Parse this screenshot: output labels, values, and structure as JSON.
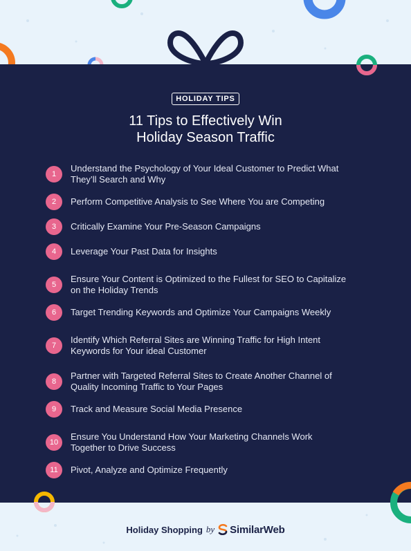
{
  "badge": "HOLIDAY TIPS",
  "title_line1": "11 Tips to Effectively Win",
  "title_line2": "Holiday Season Traffic",
  "tips": [
    {
      "num": "1",
      "line1": "Understand the Psychology of Your Ideal Customer to Predict What",
      "line2": "They’ll Search and Why"
    },
    {
      "num": "2",
      "line1": "Perform Competitive Analysis to See Where You are Competing",
      "line2": ""
    },
    {
      "num": "3",
      "line1": "Critically Examine Your Pre-Season Campaigns",
      "line2": ""
    },
    {
      "num": "4",
      "line1": "Leverage Your Past Data for Insights",
      "line2": ""
    },
    {
      "num": "5",
      "line1": "Ensure Your Content is Optimized to the Fullest for SEO to Capitalize",
      "line2": "on the Holiday Trends"
    },
    {
      "num": "6",
      "line1": "Target Trending Keywords and Optimize Your Campaigns Weekly",
      "line2": ""
    },
    {
      "num": "7",
      "line1": "Identify Which Referral Sites are Winning Traffic for High Intent",
      "line2": "Keywords for Your ideal Customer"
    },
    {
      "num": "8",
      "line1": "Partner with Targeted Referral Sites to Create Another Channel of",
      "line2": "Quality Incoming Traffic to Your Pages"
    },
    {
      "num": "9",
      "line1": "Track and Measure Social Media Presence",
      "line2": ""
    },
    {
      "num": "10",
      "line1": "Ensure You Understand How Your Marketing Channels Work",
      "line2": "Together to Drive Success"
    },
    {
      "num": "11",
      "line1": "Pivot, Analyze and Optimize Frequently",
      "line2": ""
    }
  ],
  "footer": {
    "prefix": "Holiday Shopping",
    "by": "by",
    "brand": "SimilarWeb"
  },
  "colors": {
    "navy": "#1a2146",
    "light_bg": "#e9f3fb",
    "pink": "#e8668e",
    "blue": "#4a86e8",
    "green": "#1ab07e",
    "yellow": "#f5b800",
    "orange": "#f47a20"
  },
  "icons": [
    "bow-icon",
    "similarweb-logo-icon"
  ]
}
